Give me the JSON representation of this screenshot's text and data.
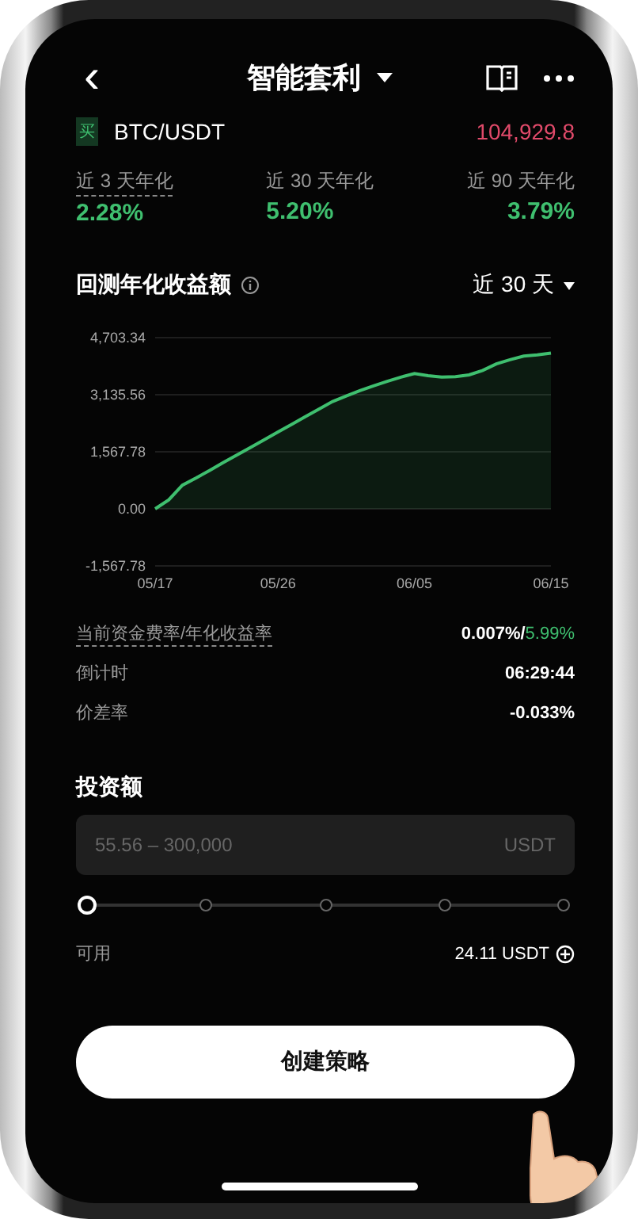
{
  "header": {
    "title": "智能套利",
    "back_icon": "‹"
  },
  "pair": {
    "tag": "买",
    "name": "BTC/USDT",
    "price": "104,929.8"
  },
  "stats": [
    {
      "label": "近 3 天年化",
      "value": "2.28%",
      "hint": true
    },
    {
      "label": "近 30 天年化",
      "value": "5.20%",
      "hint": false
    },
    {
      "label": "近 90 天年化",
      "value": "3.79%",
      "hint": false
    }
  ],
  "chart_section": {
    "title": "回测年化收益额",
    "period": "近 30 天",
    "chart_data": {
      "type": "area",
      "categories": [
        "05/17",
        null,
        null,
        null,
        null,
        null,
        null,
        null,
        null,
        "05/26",
        null,
        null,
        null,
        null,
        null,
        null,
        null,
        null,
        null,
        "06/05",
        null,
        null,
        null,
        null,
        null,
        null,
        null,
        null,
        null,
        "06/15"
      ],
      "series": [
        {
          "color": "#3fbf6f",
          "values": [
            0,
            250,
            650,
            850,
            1060,
            1270,
            1480,
            1690,
            1900,
            2110,
            2320,
            2530,
            2740,
            2950,
            3100,
            3250,
            3380,
            3500,
            3620,
            3720,
            3660,
            3620,
            3630,
            3680,
            3800,
            3980,
            4100,
            4200,
            4230,
            4280
          ]
        }
      ],
      "grid": true,
      "ylim": [
        -1567.78,
        4703.34
      ],
      "yticks": [
        {
          "value": -1567.78,
          "label": "-1,567.78"
        },
        {
          "value": 0,
          "label": "0.00"
        },
        {
          "value": 1567.78,
          "label": "1,567.78"
        },
        {
          "value": 3135.56,
          "label": "3,135.56"
        },
        {
          "value": 4703.34,
          "label": "4,703.34"
        }
      ]
    }
  },
  "info_rows": [
    {
      "label": "当前资金费率/年化收益率",
      "value": "0.007%/",
      "value_accent": "5.99%",
      "hint": true
    },
    {
      "label": "倒计时",
      "value": "06:29:44",
      "hint": false
    },
    {
      "label": "价差率",
      "value": "-0.033%",
      "hint": false
    }
  ],
  "investment": {
    "title": "投资额",
    "placeholder": "55.56 – 300,000",
    "unit": "USDT",
    "slider": {
      "level": 0
    }
  },
  "available": {
    "label": "可用",
    "value": "24.11 USDT"
  },
  "button": "创建策略"
}
